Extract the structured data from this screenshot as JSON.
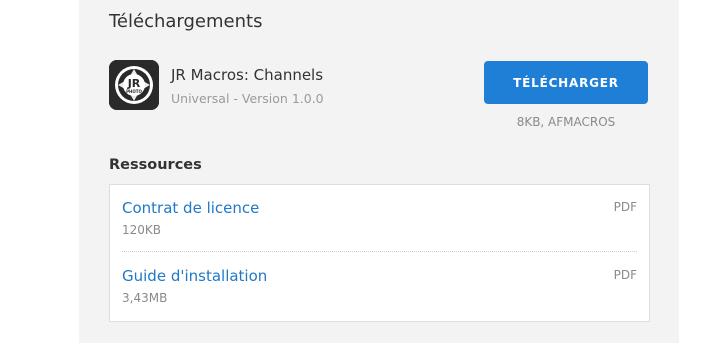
{
  "section_title": "Téléchargements",
  "app": {
    "icon_text_top": "JR",
    "icon_text_bottom": "PHOTO",
    "name": "JR Macros: Channels",
    "meta": "Universal - Version 1.0.0"
  },
  "download": {
    "label": "TÉLÉCHARGER",
    "meta": "8KB, AFMACROS"
  },
  "resources": {
    "title": "Ressources",
    "items": [
      {
        "label": "Contrat de licence",
        "size": "120KB",
        "type": "PDF"
      },
      {
        "label": "Guide d'installation",
        "size": "3,43MB",
        "type": "PDF"
      }
    ]
  },
  "colors": {
    "accent": "#1f7fd6",
    "link": "#1f78c8",
    "panel_bg": "#f3f3f3"
  }
}
